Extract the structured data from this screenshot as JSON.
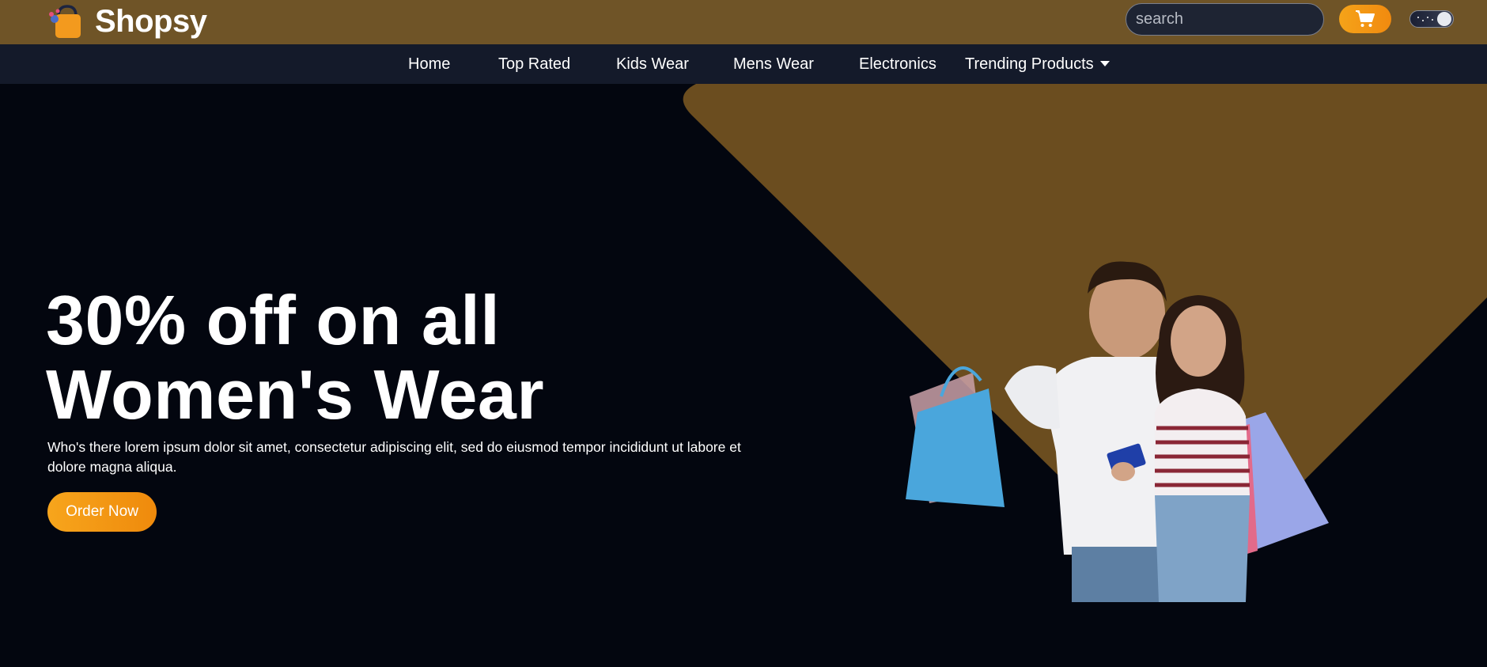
{
  "header": {
    "brand_name": "Shopsy",
    "logo_icon": "shopping-bag-icon",
    "search": {
      "placeholder": "search",
      "value": "",
      "icon": "search-icon"
    },
    "cart_icon": "cart-icon",
    "theme_toggle_icon": "moon-toggle-icon"
  },
  "nav": {
    "items": [
      {
        "label": "Home"
      },
      {
        "label": "Top Rated"
      },
      {
        "label": "Kids Wear"
      },
      {
        "label": "Mens Wear"
      },
      {
        "label": "Electronics"
      },
      {
        "label": "Trending Products"
      }
    ],
    "dropdown_icon": "caret-down-icon"
  },
  "hero": {
    "title_line1": "30% off on all",
    "title_line2": "Women's Wear",
    "description": "Who's there lorem ipsum dolor sit amet, consectetur adipiscing elit, sed do eiusmod tempor incididunt ut labore et dolore magna aliqua.",
    "cta_label": "Order Now"
  },
  "colors": {
    "header_bg": "#6f5427",
    "nav_bg": "#141a2a",
    "hero_bg": "#03060f",
    "accent": "#f5a319",
    "hero_shape": "#6b4d1f"
  }
}
